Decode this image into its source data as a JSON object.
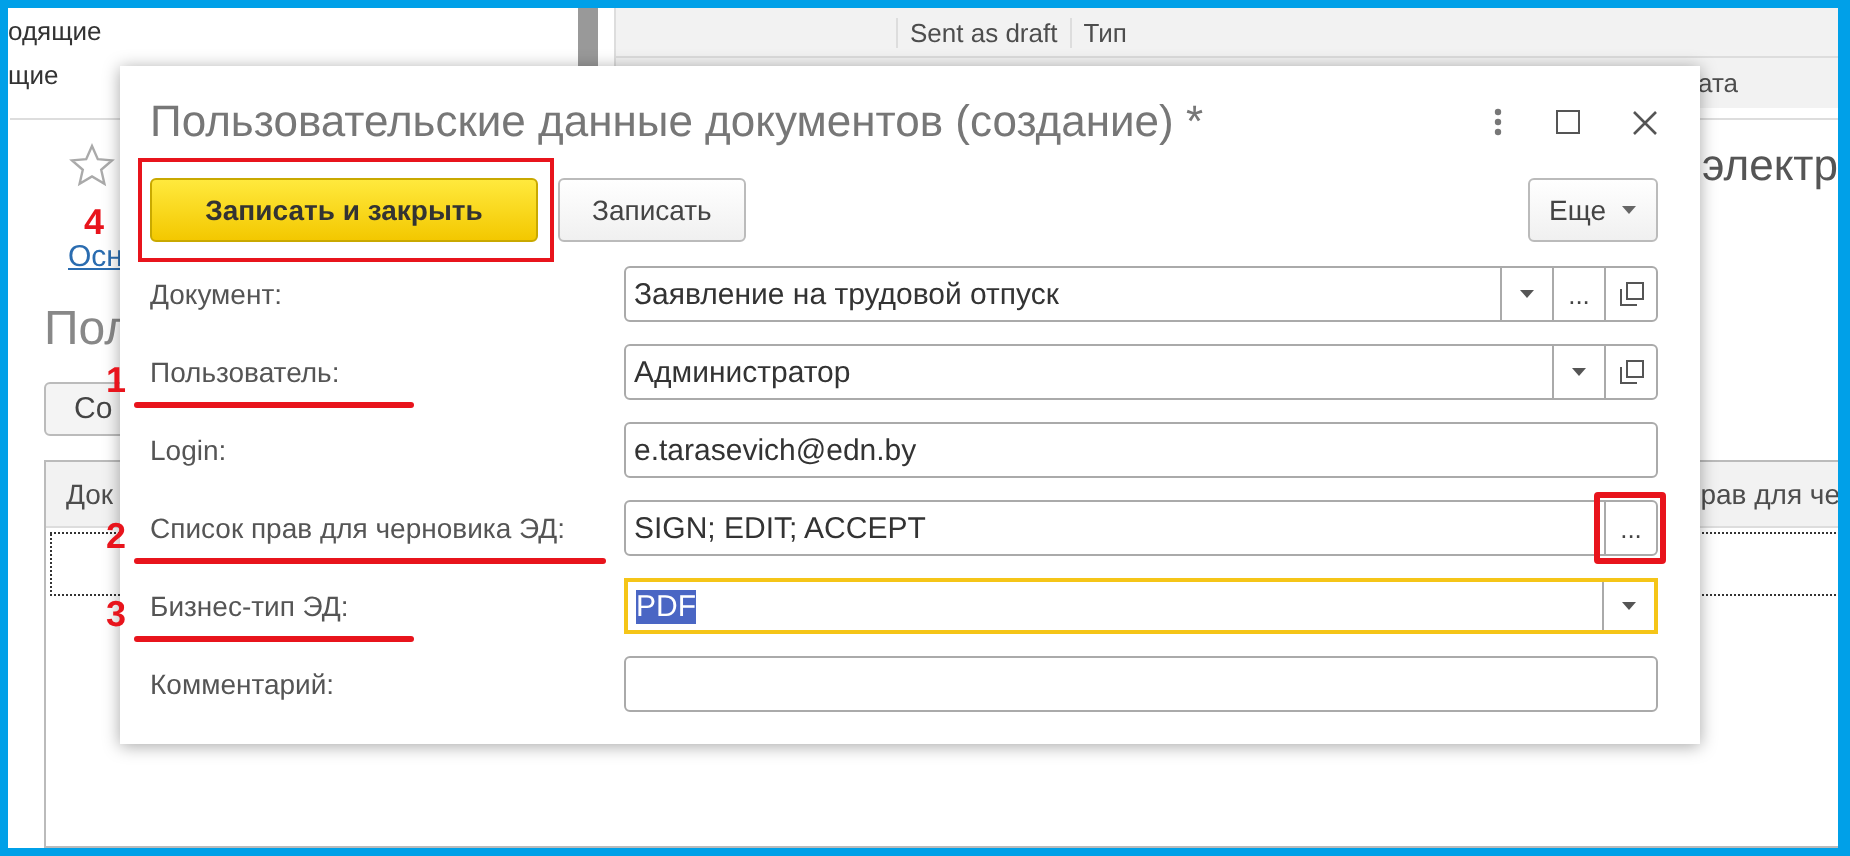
{
  "background": {
    "list_items": [
      "одящие",
      "щие"
    ],
    "header_columns": [
      "Sent as draft",
      "Тип"
    ],
    "subheader_columns": [
      "ата"
    ],
    "window": {
      "link": "Осн",
      "heading": "Пол",
      "button": "Со",
      "columns": [
        "Док",
        "рав для че"
      ],
      "side_text": "электр"
    }
  },
  "dialog": {
    "title": "Пользовательские данные документов (создание) *",
    "toolbar": [
      {
        "label": "Записать и закрыть",
        "kind": "default",
        "annotation": "4"
      },
      {
        "label": "Записать",
        "kind": "plain"
      }
    ],
    "more_button": "Еще",
    "fields": [
      {
        "label": "Документ:",
        "value": "Заявление на трудовой отпуск",
        "focused": false,
        "buttons": [
          {
            "kind": "dropdown"
          },
          {
            "kind": "select",
            "label": "..."
          },
          {
            "kind": "open"
          }
        ]
      },
      {
        "label": "Пользователь:",
        "value": "Администратор",
        "focused": false,
        "annotation": "1",
        "buttons": [
          {
            "kind": "dropdown"
          },
          {
            "kind": "open"
          }
        ]
      },
      {
        "label": "Login:",
        "value": "e.tarasevich@edn.by",
        "focused": false
      },
      {
        "label": "Список прав для черновика ЭД:",
        "value": "SIGN; EDIT; ACCEPT",
        "focused": false,
        "annotation": "2",
        "buttons": [
          {
            "kind": "select",
            "label": "...",
            "highlighted": true
          }
        ]
      },
      {
        "label": "Бизнес-тип ЭД:",
        "value": "PDF",
        "focused": true,
        "annotation": "3",
        "buttons": [
          {
            "kind": "dropdown"
          }
        ]
      },
      {
        "label": "Комментарий:",
        "focused": false
      }
    ]
  }
}
